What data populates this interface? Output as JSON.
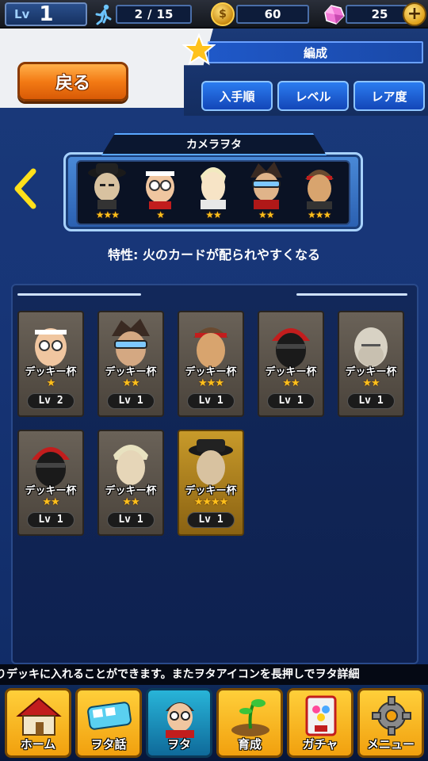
{
  "status": {
    "level_label": "Lv",
    "level_value": "1",
    "stamina_current": "2",
    "stamina_sep": "/",
    "stamina_max": "15",
    "coins": "60",
    "gems": "25",
    "plus": "+"
  },
  "header": {
    "title": "編成",
    "back_label": "戻る",
    "sort_buttons": [
      "入手順",
      "レベル",
      "レア度"
    ]
  },
  "deck": {
    "name": "カメラヲタ",
    "trait": "特性: 火のカードが配られやすくなる",
    "members": [
      {
        "stars": "★★★"
      },
      {
        "stars": "★"
      },
      {
        "stars": "★★"
      },
      {
        "stars": "★★"
      },
      {
        "stars": "★★★"
      }
    ]
  },
  "cards": [
    {
      "title": "デッキー杯",
      "stars": "★",
      "level": "Lv 2"
    },
    {
      "title": "デッキー杯",
      "stars": "★★",
      "level": "Lv 1"
    },
    {
      "title": "デッキー杯",
      "stars": "★★★",
      "level": "Lv 1"
    },
    {
      "title": "デッキー杯",
      "stars": "★★",
      "level": "Lv 1"
    },
    {
      "title": "デッキー杯",
      "stars": "★★",
      "level": "Lv 1"
    },
    {
      "title": "デッキー杯",
      "stars": "★★",
      "level": "Lv 1"
    },
    {
      "title": "デッキー杯",
      "stars": "★★",
      "level": "Lv 1"
    },
    {
      "title": "デッキー杯",
      "stars": "★★★★",
      "level": "Lv 1"
    }
  ],
  "ticker": "したりデッキに入れることができます。またヲタアイコンを長押しでヲタ詳細",
  "nav": [
    {
      "label": "ホーム",
      "icon": "house-icon"
    },
    {
      "label": "ヲタ話",
      "icon": "train-icon"
    },
    {
      "label": "ヲタ",
      "icon": "character-icon"
    },
    {
      "label": "育成",
      "icon": "sprout-icon"
    },
    {
      "label": "ガチャ",
      "icon": "gacha-machine-icon"
    },
    {
      "label": "メニュー",
      "icon": "gear-icon"
    }
  ],
  "colors": {
    "accent_orange": "#f37a14",
    "sort_blue": "#1f5fd8",
    "star_gold": "#ffc01c",
    "nav_yellow": "#f1a00e",
    "nav_active": "#1a8ec0"
  }
}
